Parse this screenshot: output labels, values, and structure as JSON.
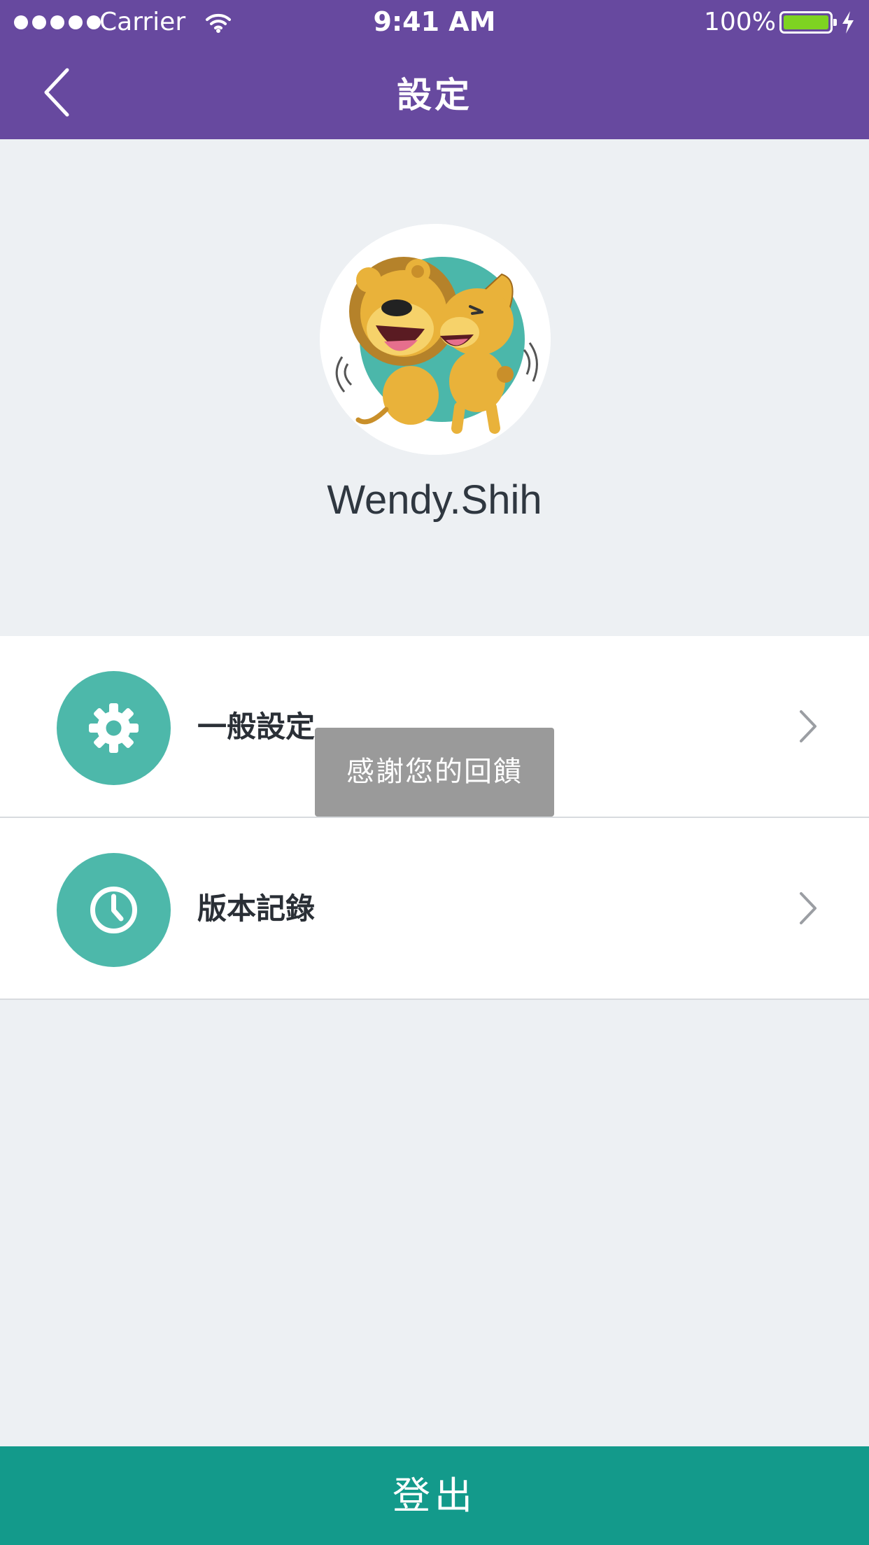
{
  "status_bar": {
    "carrier": "Carrier",
    "time": "9:41 AM",
    "battery_percent": "100%",
    "battery_level": 1.0,
    "signal_icon": "signal-dots-icon",
    "wifi_icon": "wifi-icon",
    "charging_icon": "lightning-bolt-icon"
  },
  "nav": {
    "title": "設定",
    "back_icon": "chevron-left-icon"
  },
  "profile": {
    "avatar_icon": "lion-mascot-avatar",
    "username": "Wendy.Shih"
  },
  "settings": {
    "items": [
      {
        "label": "一般設定",
        "icon": "gear-icon"
      },
      {
        "label": "版本記錄",
        "icon": "clock-icon"
      }
    ],
    "chevron_icon": "chevron-right-icon"
  },
  "toast": {
    "message": "感謝您的回饋"
  },
  "footer": {
    "logout_label": "登出"
  },
  "colors": {
    "header_bg": "#67499f",
    "page_bg": "#edf0f3",
    "icon_bg": "#4db8aa",
    "logout_bg": "#139a8b",
    "toast_bg": "#9a9a9a",
    "battery_fill": "#7ed321"
  }
}
